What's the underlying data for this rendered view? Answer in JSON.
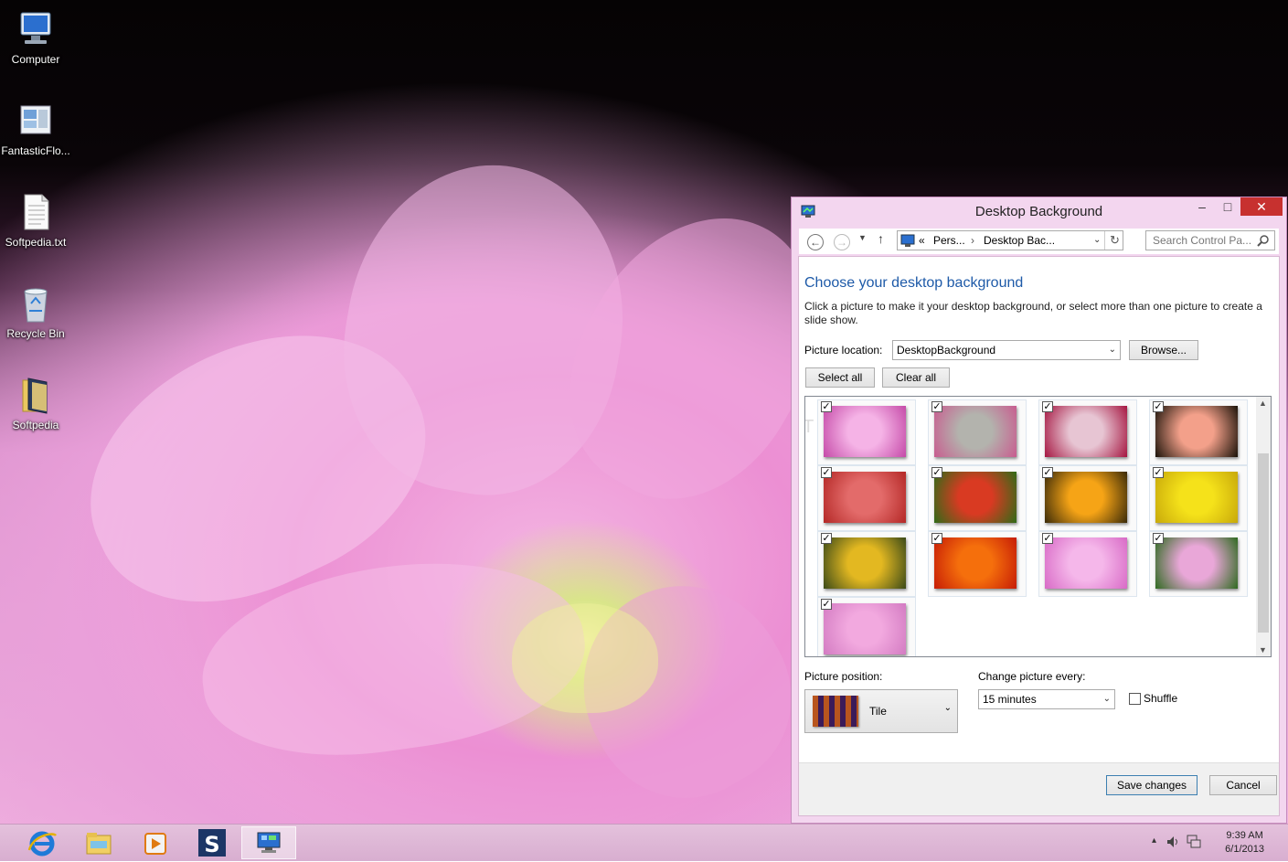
{
  "desktop": {
    "icons": [
      {
        "label": "Computer",
        "icon": "computer-icon"
      },
      {
        "label": "FantasticFlo...",
        "icon": "app-screenshot-icon"
      },
      {
        "label": "Softpedia.txt",
        "icon": "text-file-icon"
      },
      {
        "label": "Recycle Bin",
        "icon": "recycle-bin-icon"
      },
      {
        "label": "Softpedia",
        "icon": "folder-icon"
      }
    ]
  },
  "window": {
    "title": "Desktop Background",
    "minimize": "–",
    "maximize": "□",
    "close": "✕",
    "breadcrumb_prefix": "«",
    "breadcrumb_1": "Pers...",
    "breadcrumb_sep": "›",
    "breadcrumb_2": "Desktop Bac...",
    "search_placeholder": "Search Control Pa...",
    "heading": "Choose your desktop background",
    "description": "Click a picture to make it your desktop background, or select more than one picture to create a slide show.",
    "picture_location_label": "Picture location:",
    "picture_location_value": "DesktopBackground",
    "browse_label": "Browse...",
    "select_all_label": "Select all",
    "clear_all_label": "Clear all",
    "picture_position_label": "Picture position:",
    "picture_position_value": "Tile",
    "change_picture_label": "Change picture every:",
    "change_picture_value": "15 minutes",
    "shuffle_label": "Shuffle",
    "save_label": "Save changes",
    "cancel_label": "Cancel",
    "watermark": "SOFTPEDIA"
  },
  "gallery": {
    "images": [
      {
        "name": "pink-dahlia",
        "checked": true,
        "colors": [
          "#f5b3e6",
          "#c54aa8"
        ]
      },
      {
        "name": "pink-blossom-branch",
        "checked": true,
        "colors": [
          "#b3b3ad",
          "#c85c8f"
        ]
      },
      {
        "name": "red-white-dahlia",
        "checked": true,
        "colors": [
          "#e7c5d3",
          "#a51540"
        ]
      },
      {
        "name": "peach-rose",
        "checked": true,
        "colors": [
          "#f3a08a",
          "#1a1208"
        ]
      },
      {
        "name": "red-aster",
        "checked": true,
        "colors": [
          "#e36b6a",
          "#b42826"
        ]
      },
      {
        "name": "red-zinnia",
        "checked": true,
        "colors": [
          "#d93a22",
          "#2f6b17"
        ]
      },
      {
        "name": "orange-gerbera",
        "checked": true,
        "colors": [
          "#f6a416",
          "#3a2a08"
        ]
      },
      {
        "name": "yellow-chrysanthemum",
        "checked": true,
        "colors": [
          "#f5e21a",
          "#c8a90a"
        ]
      },
      {
        "name": "sunflowers",
        "checked": true,
        "colors": [
          "#e3b821",
          "#3b4a18"
        ]
      },
      {
        "name": "orange-chrysanthemum",
        "checked": true,
        "colors": [
          "#f56f0c",
          "#c61c06"
        ]
      },
      {
        "name": "pink-dahlia-2",
        "checked": true,
        "colors": [
          "#f5b7ea",
          "#d86ac6"
        ]
      },
      {
        "name": "pink-lily",
        "checked": true,
        "colors": [
          "#e9a7d8",
          "#2e6a1f"
        ]
      },
      {
        "name": "pink-dahlia-3",
        "checked": true,
        "colors": [
          "#f2a9df",
          "#d37bc2"
        ]
      }
    ]
  },
  "taskbar": {
    "items": [
      {
        "name": "internet-explorer-icon",
        "active": false
      },
      {
        "name": "file-explorer-icon",
        "active": false
      },
      {
        "name": "media-player-icon",
        "active": false
      },
      {
        "name": "softpedia-app-icon",
        "active": false
      },
      {
        "name": "control-panel-icon",
        "active": true
      }
    ],
    "time": "9:39 AM",
    "date": "6/1/2013",
    "tray_chevron": "▴"
  },
  "colors": {
    "accent_link": "#1e5aa8",
    "close_red": "#c7312f",
    "window_frame": "#f3d6ef"
  }
}
